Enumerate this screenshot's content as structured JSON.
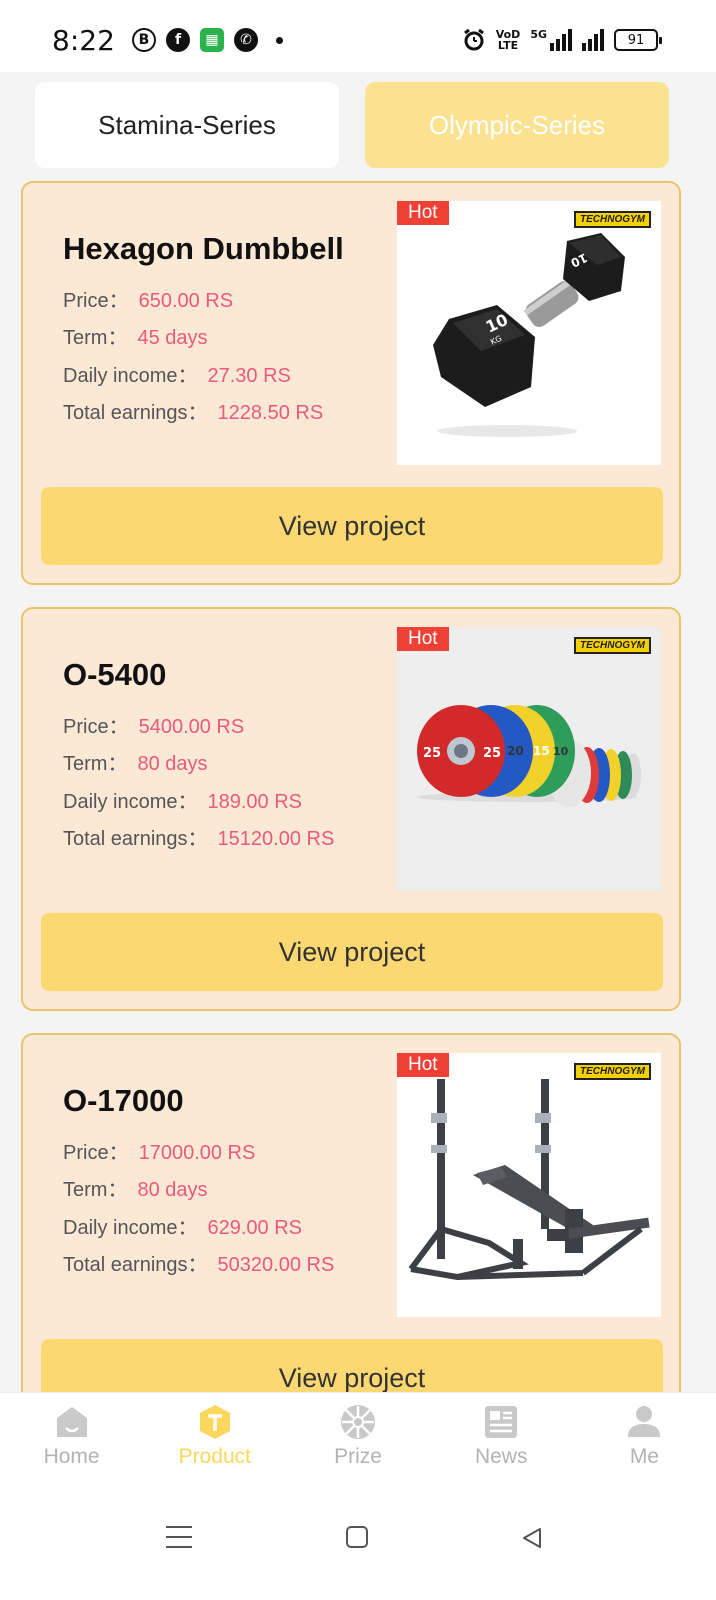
{
  "status_bar": {
    "time": "8:22",
    "left_icons": [
      "b-icon",
      "facebook-icon",
      "green-app-icon",
      "whatsapp-icon",
      "dot-icon"
    ],
    "network_label_top": "VoD",
    "network_label_bottom": "LTE",
    "network_type": "5G",
    "battery": "91"
  },
  "tabs": [
    {
      "label": "Stamina-Series",
      "active": false
    },
    {
      "label": "Olympic-Series",
      "active": true
    }
  ],
  "products": [
    {
      "name": "Hexagon Dumbbell",
      "badge": "Hot",
      "brand": "TECHNOGYM",
      "price_label": "Price：",
      "price": "650.00 RS",
      "term_label": "Term：",
      "term": "45 days",
      "daily_label": "Daily income：",
      "daily": "27.30 RS",
      "total_label": "Total earnings：",
      "total": "1228.50 RS",
      "button": "View project",
      "image": "hexagon-dumbbell-image"
    },
    {
      "name": "O-5400",
      "badge": "Hot",
      "brand": "TECHNOGYM",
      "price_label": "Price：",
      "price": "5400.00 RS",
      "term_label": "Term：",
      "term": "80 days",
      "daily_label": "Daily income：",
      "daily": "189.00 RS",
      "total_label": "Total earnings：",
      "total": "15120.00 RS",
      "button": "View project",
      "image": "weight-plates-image"
    },
    {
      "name": "O-17000",
      "badge": "Hot",
      "brand": "TECHNOGYM",
      "price_label": "Price：",
      "price": "17000.00 RS",
      "term_label": "Term：",
      "term": "80 days",
      "daily_label": "Daily income：",
      "daily": "629.00 RS",
      "total_label": "Total earnings：",
      "total": "50320.00 RS",
      "button": "View project",
      "image": "incline-bench-rack-image"
    }
  ],
  "bottom_nav": [
    {
      "label": "Home",
      "icon": "home-icon",
      "active": false
    },
    {
      "label": "Product",
      "icon": "product-icon",
      "active": true
    },
    {
      "label": "Prize",
      "icon": "prize-wheel-icon",
      "active": false
    },
    {
      "label": "News",
      "icon": "news-icon",
      "active": false
    },
    {
      "label": "Me",
      "icon": "person-icon",
      "active": false
    }
  ],
  "plate_numbers": {
    "a": "25",
    "b": "25",
    "c": "20",
    "d": "15",
    "e": "10"
  },
  "dumbbell_weight": "10",
  "dumbbell_unit": "KG",
  "colors": {
    "accent": "#fbd872",
    "card_bg": "#fbe9d6",
    "card_border": "#e9c46a",
    "value_pink": "#ea5a7a",
    "hot_red": "#ee4035",
    "inactive_gray": "#b3b3b3"
  }
}
